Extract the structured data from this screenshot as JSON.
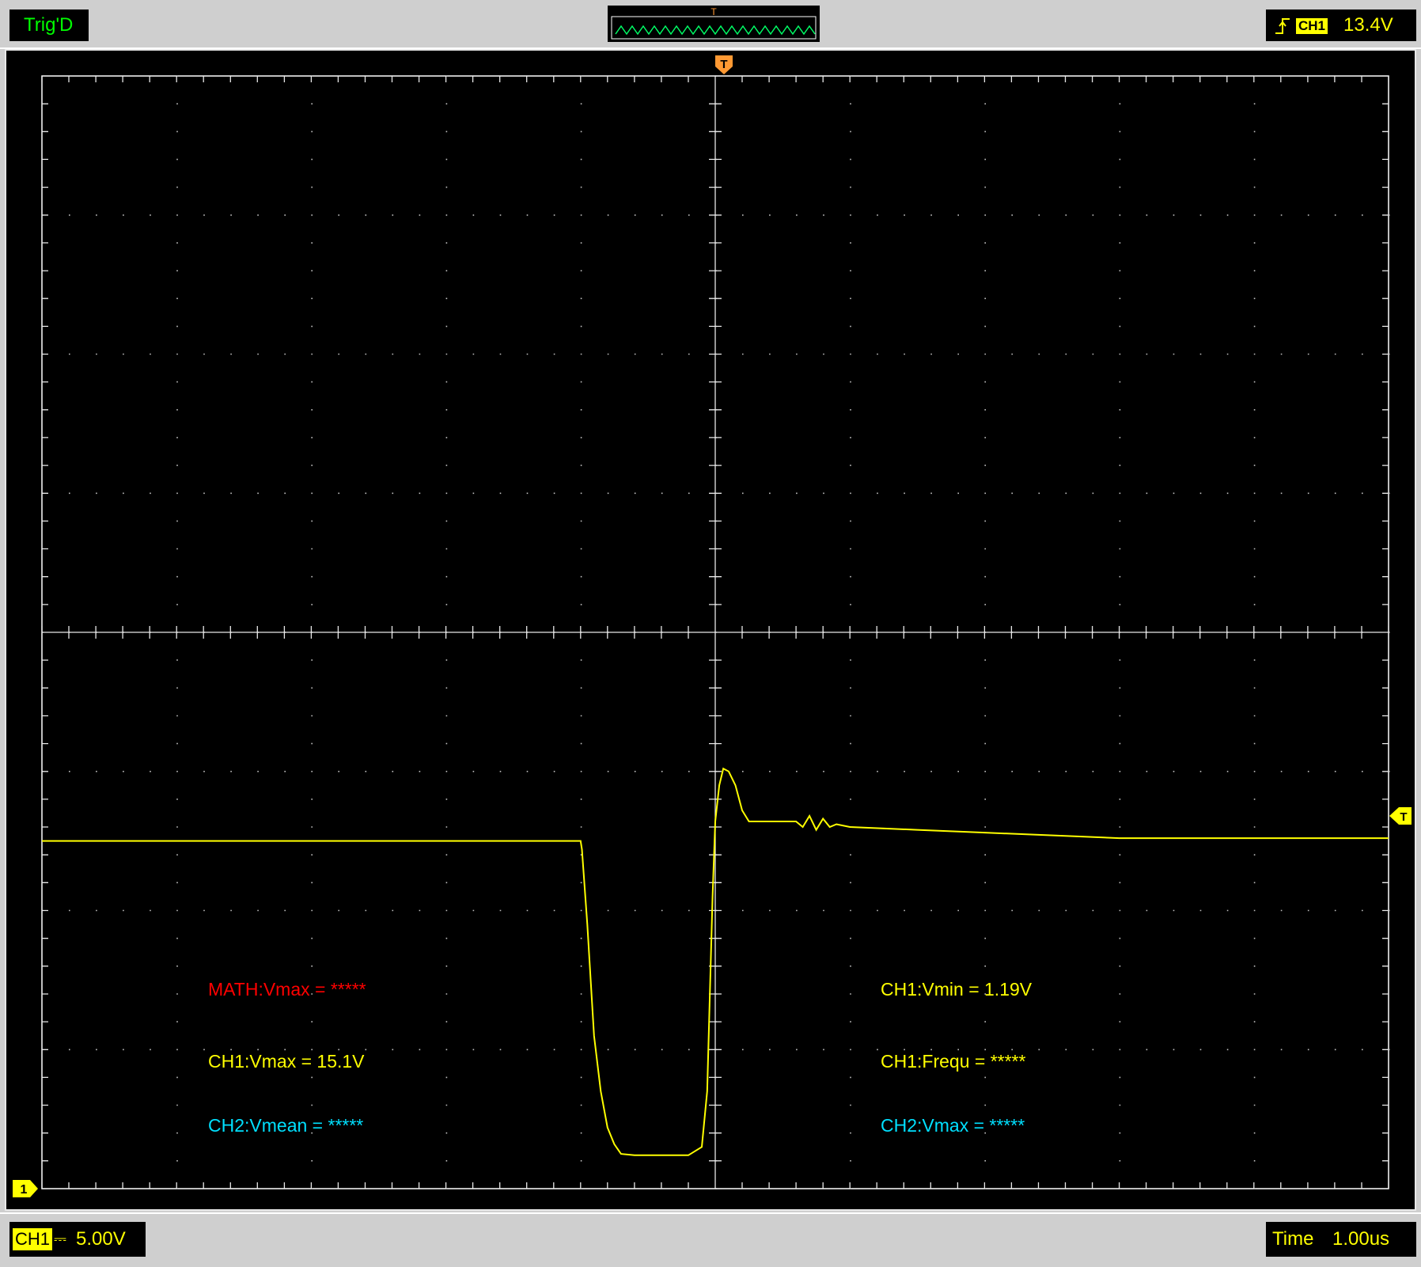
{
  "status": {
    "trigger_state": "Trig'D"
  },
  "trigger": {
    "marker": "T",
    "source": "CH1",
    "level": "13.4V",
    "edge_icon": "rising-edge-icon"
  },
  "channels": {
    "ch1": {
      "name": "CH1",
      "marker": "1",
      "coupling_symbol": "⎓",
      "scale": "5.00V",
      "color": "#ffff00"
    }
  },
  "timebase": {
    "label": "Time",
    "value": "1.00us"
  },
  "measurements": {
    "math_vmax": "MATH:Vmax = *****",
    "ch1_vmax": "CH1:Vmax = 15.1V",
    "ch2_vmean": "CH2:Vmean = *****",
    "ch1_vmin": "CH1:Vmin = 1.19V",
    "ch1_frequ": "CH1:Frequ = *****",
    "ch2_vmax": "CH2:Vmax = *****"
  },
  "colors": {
    "math": "#ff0000",
    "ch1": "#ffff00",
    "ch2": "#00e0ff",
    "trigger_marker": "#ff9933",
    "trig_status": "#00ff00"
  },
  "chart_data": {
    "type": "line",
    "xlabel": "",
    "ylabel": "",
    "x_divisions": 10,
    "y_divisions": 8,
    "x_unit": "us",
    "y_unit": "V",
    "x_per_div": 1.0,
    "y_per_div": 5.0,
    "xlim": [
      -5,
      5
    ],
    "ylim": [
      0,
      40
    ],
    "grid": true,
    "series": [
      {
        "name": "CH1",
        "x": [
          -5.0,
          -2.0,
          -1.0,
          -0.99,
          -0.95,
          -0.9,
          -0.85,
          -0.8,
          -0.75,
          -0.7,
          -0.6,
          -0.4,
          -0.2,
          -0.1,
          -0.06,
          -0.04,
          -0.02,
          0.0,
          0.03,
          0.06,
          0.1,
          0.15,
          0.2,
          0.25,
          0.3,
          0.5,
          0.6,
          0.65,
          0.7,
          0.75,
          0.8,
          0.85,
          0.9,
          1.0,
          1.5,
          2.0,
          3.0,
          4.0,
          5.0
        ],
        "y": [
          12.5,
          12.5,
          12.5,
          12.2,
          9.5,
          5.5,
          3.5,
          2.2,
          1.6,
          1.25,
          1.2,
          1.2,
          1.2,
          1.5,
          3.5,
          7.0,
          10.5,
          13.2,
          14.5,
          15.1,
          15.0,
          14.5,
          13.6,
          13.2,
          13.2,
          13.2,
          13.2,
          13.0,
          13.4,
          12.9,
          13.3,
          13.0,
          13.1,
          13.0,
          12.9,
          12.8,
          12.6,
          12.6,
          12.6
        ]
      }
    ]
  }
}
